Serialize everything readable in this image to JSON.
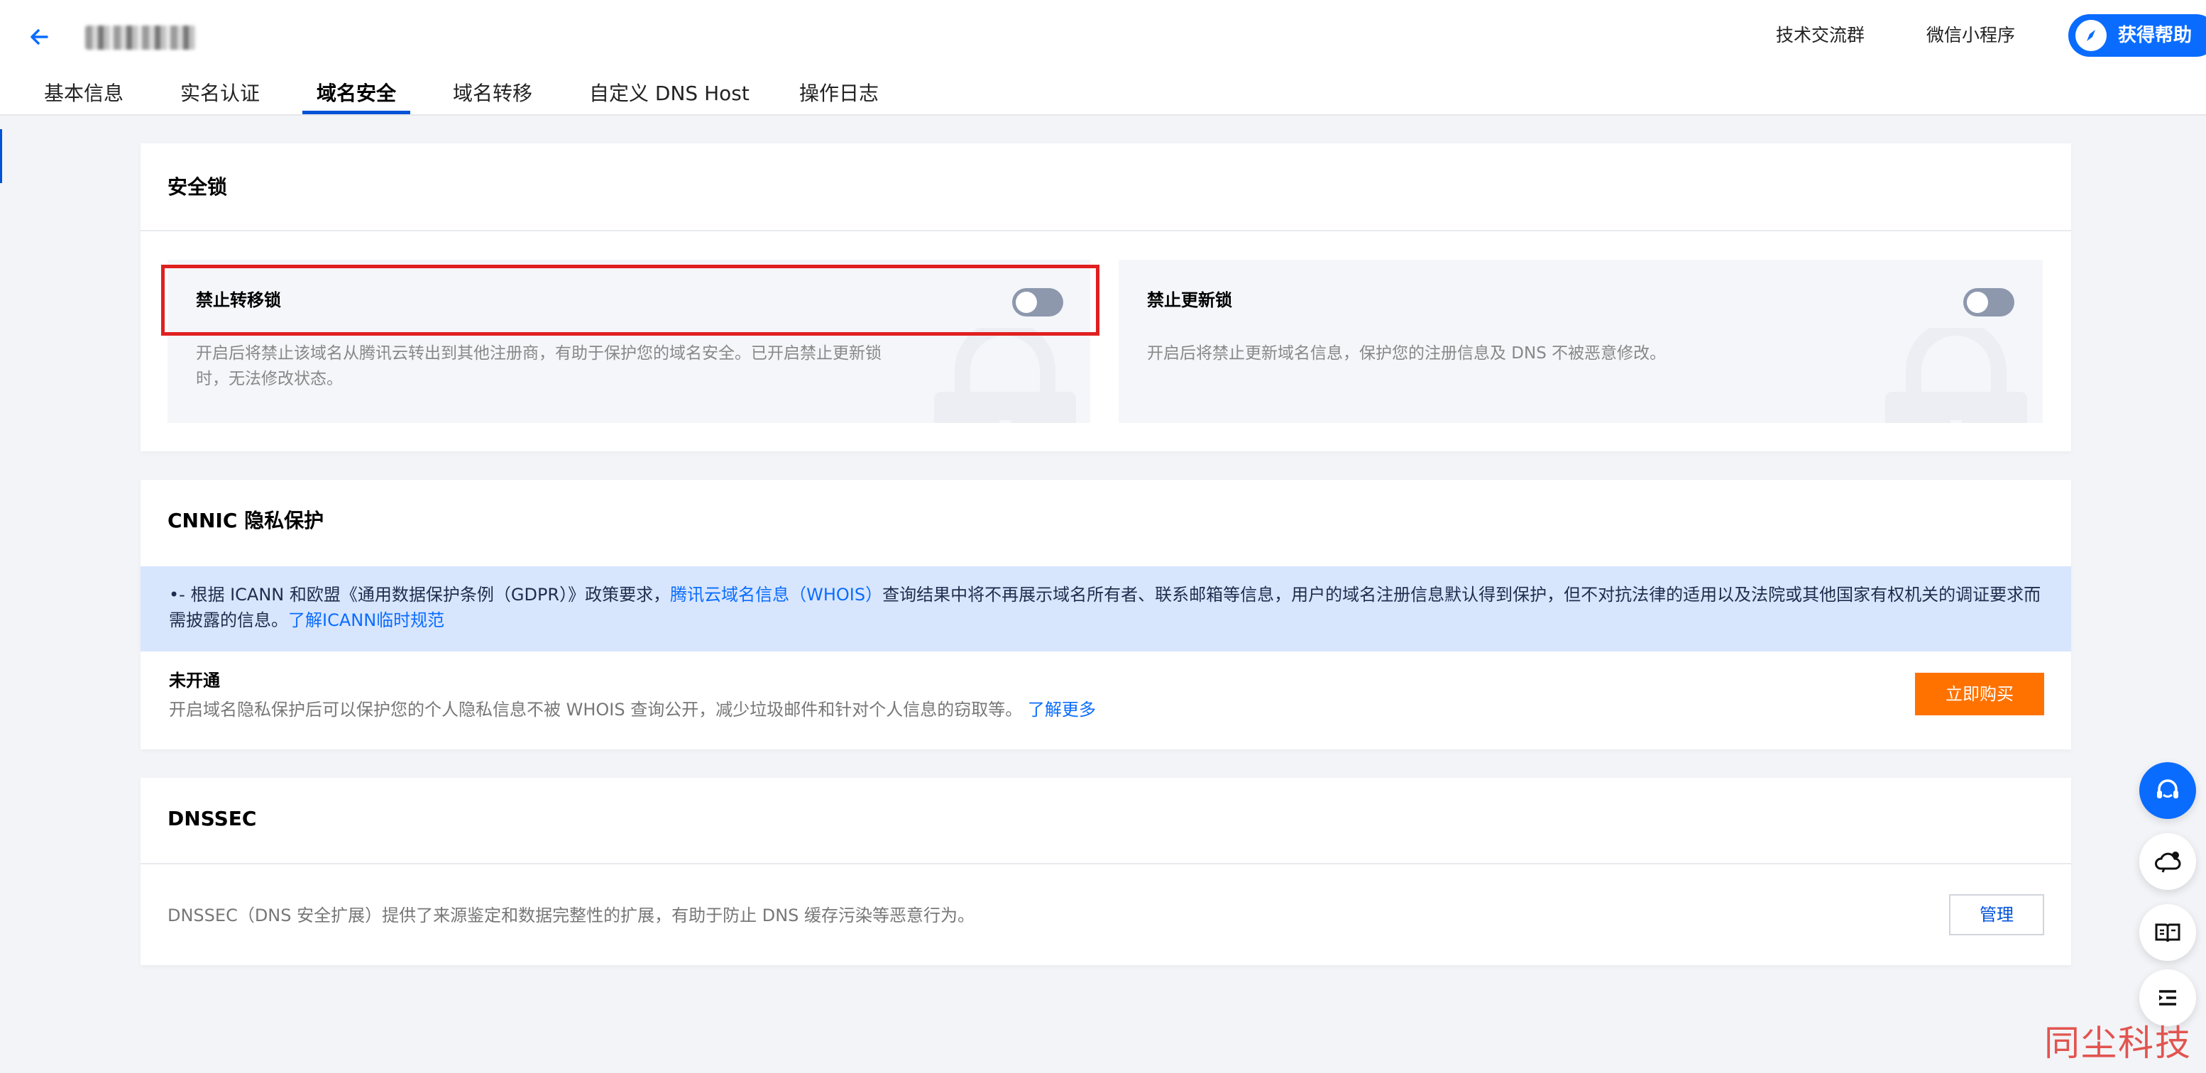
{
  "header": {
    "links": [
      "技术交流群",
      "微信小程序"
    ],
    "help_button": "获得帮助"
  },
  "tabs": [
    "基本信息",
    "实名认证",
    "域名安全",
    "域名转移",
    "自定义 DNS Host",
    "操作日志"
  ],
  "active_tab": "域名安全",
  "security_lock": {
    "title": "安全锁",
    "transfer_lock": {
      "title": "禁止转移锁",
      "desc": "开启后将禁止该域名从腾讯云转出到其他注册商，有助于保护您的域名安全。已开启禁止更新锁时，无法修改状态。",
      "enabled": false
    },
    "update_lock": {
      "title": "禁止更新锁",
      "desc": "开启后将禁止更新域名信息，保护您的注册信息及 DNS 不被恶意修改。",
      "enabled": false
    }
  },
  "privacy": {
    "title": "CNNIC 隐私保护",
    "notice_bullet": "•",
    "notice_prefix": "- 根据 ICANN 和欧盟《通用数据保护条例（GDPR）》政策要求，",
    "notice_link1": "腾讯云域名信息（WHOIS）",
    "notice_middle": "查询结果中将不再展示域名所有者、联系邮箱等信息，用户的域名注册信息默认得到保护，但不对抗法律的适用以及法院或其他国家有权机关的调证要求而需披露的信息。",
    "notice_link2": "了解ICANN临时规范",
    "status": "未开通",
    "status_desc": "开启域名隐私保护后可以保护您的个人隐私信息不被 WHOIS 查询公开，减少垃圾邮件和针对个人信息的窃取等。",
    "learn_more": "了解更多",
    "buy_button": "立即购买"
  },
  "dnssec": {
    "title": "DNSSEC",
    "desc": "DNSSEC（DNS 安全扩展）提供了来源鉴定和数据完整性的扩展，有助于防止 DNS 缓存污染等恶意行为。",
    "manage_button": "管理"
  },
  "float_buttons": [
    "headset-icon",
    "cloud-chat-icon",
    "book-icon",
    "list-icon"
  ],
  "watermark": "同尘科技",
  "colors": {
    "accent": "#0052d9",
    "help_button": "#0a6cff",
    "buy_button": "#ff7200",
    "highlight_border": "#e02020",
    "notice_bg": "#d8e6fd"
  }
}
